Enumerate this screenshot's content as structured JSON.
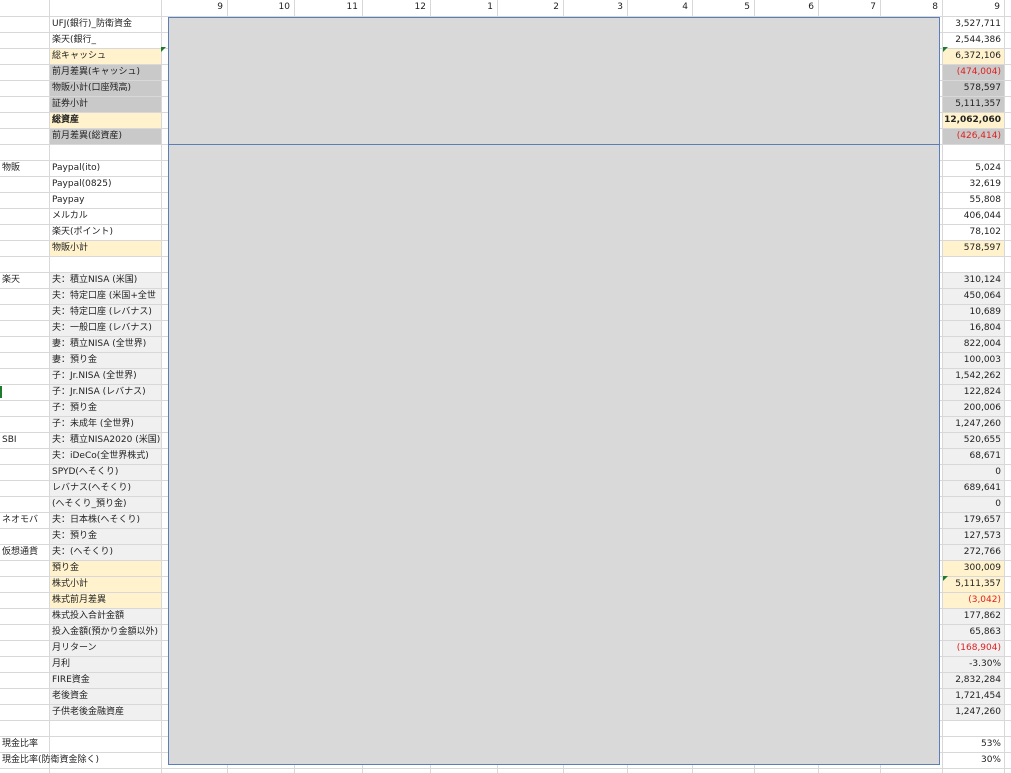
{
  "column_headers": [
    "9",
    "10",
    "11",
    "12",
    "1",
    "2",
    "3",
    "4",
    "5",
    "6",
    "7",
    "8",
    "9"
  ],
  "colors": {
    "gray_fill": "#c9c9c9",
    "yellow_fill": "#fff2cc",
    "band_fill": "#f0f0f0",
    "negative_text": "#e02020",
    "overlay_fill": "#d9d9d9",
    "overlay_border": "#5b7db8"
  },
  "rows": [
    {
      "cat": "",
      "label": "UFJ(銀行)_防衛資金",
      "value": "3,527,711",
      "style": "white"
    },
    {
      "cat": "",
      "label": "楽天(銀行_",
      "value": "2,544,386",
      "style": "white"
    },
    {
      "cat": "",
      "label": "総キャッシュ",
      "value": "6,372,106",
      "style": "yellow"
    },
    {
      "cat": "",
      "label": "前月差異(キャッシュ)",
      "value": "(474,004)",
      "style": "gray",
      "neg": true
    },
    {
      "cat": "",
      "label": "物販小計(口座残高)",
      "value": "578,597",
      "style": "gray"
    },
    {
      "cat": "",
      "label": "証券小計",
      "value": "5,111,357",
      "style": "gray"
    },
    {
      "cat": "",
      "label": "総資産",
      "value": "12,062,060",
      "style": "yellow",
      "bold": true
    },
    {
      "cat": "",
      "label": "前月差異(総資産)",
      "value": "(426,414)",
      "style": "gray",
      "neg": true
    },
    {
      "cat": "",
      "label": "",
      "value": "",
      "style": "white"
    },
    {
      "cat": "物販",
      "label": "Paypal(ito)",
      "value": "5,024",
      "style": "white"
    },
    {
      "cat": "",
      "label": "Paypal(0825)",
      "value": "32,619",
      "style": "white"
    },
    {
      "cat": "",
      "label": "Paypay",
      "value": "55,808",
      "style": "white"
    },
    {
      "cat": "",
      "label": "メルカル",
      "value": "406,044",
      "style": "white"
    },
    {
      "cat": "",
      "label": "楽天(ポイント)",
      "value": "78,102",
      "style": "white"
    },
    {
      "cat": "",
      "label": "物販小計",
      "value": "578,597",
      "style": "yellow"
    },
    {
      "cat": "",
      "label": "",
      "value": "",
      "style": "white"
    },
    {
      "cat": "楽天",
      "label": "夫：積立NISA (米国)",
      "value": "310,124",
      "style": "band"
    },
    {
      "cat": "",
      "label": "夫：特定口座 (米国+全世",
      "value": "450,064",
      "style": "band"
    },
    {
      "cat": "",
      "label": "夫：特定口座 (レバナス)",
      "value": "10,689",
      "style": "band"
    },
    {
      "cat": "",
      "label": "夫：一般口座 (レバナス)",
      "value": "16,804",
      "style": "band"
    },
    {
      "cat": "",
      "label": "妻：積立NISA (全世界)",
      "value": "822,004",
      "style": "band"
    },
    {
      "cat": "",
      "label": "妻：預り金",
      "value": "100,003",
      "style": "band"
    },
    {
      "cat": "",
      "label": "子：Jr.NISA (全世界)",
      "value": "1,542,262",
      "style": "band"
    },
    {
      "cat": "",
      "label": "子：Jr.NISA (レバナス)",
      "value": "122,824",
      "style": "band"
    },
    {
      "cat": "",
      "label": "子：預り金",
      "value": "200,006",
      "style": "band"
    },
    {
      "cat": "",
      "label": "子：未成年 (全世界)",
      "value": "1,247,260",
      "style": "band"
    },
    {
      "cat": "SBI",
      "label": "夫：積立NISA2020 (米国)",
      "value": "520,655",
      "style": "band"
    },
    {
      "cat": "",
      "label": "夫：iDeCo(全世界株式)",
      "value": "68,671",
      "style": "band"
    },
    {
      "cat": "",
      "label": "SPYD(へそくり)",
      "value": "0",
      "style": "band"
    },
    {
      "cat": "",
      "label": "レバナス(へそくり)",
      "value": "689,641",
      "style": "band"
    },
    {
      "cat": "",
      "label": "(へそくり_預り金)",
      "value": "0",
      "style": "band"
    },
    {
      "cat": "ネオモバ",
      "label": "夫：日本株(へそくり)",
      "value": "179,657",
      "style": "band"
    },
    {
      "cat": "",
      "label": "夫：預り金",
      "value": "127,573",
      "style": "band"
    },
    {
      "cat": "仮想通貨",
      "label": "夫：(へそくり)",
      "value": "272,766",
      "style": "band"
    },
    {
      "cat": "",
      "label": "預り金",
      "value": "300,009",
      "style": "yellow"
    },
    {
      "cat": "",
      "label": "株式小計",
      "value": "5,111,357",
      "style": "yellow"
    },
    {
      "cat": "",
      "label": "株式前月差異",
      "value": "(3,042)",
      "style": "yellow",
      "neg": true
    },
    {
      "cat": "",
      "label": "株式投入合計金額",
      "value": "177,862",
      "style": "band"
    },
    {
      "cat": "",
      "label": "投入金額(預かり金額以外)",
      "value": "65,863",
      "style": "band"
    },
    {
      "cat": "",
      "label": "月リターン",
      "value": "(168,904)",
      "style": "band",
      "neg": true
    },
    {
      "cat": "",
      "label": "月利",
      "value": "-3.30%",
      "style": "band"
    },
    {
      "cat": "",
      "label": "FIRE資金",
      "value": "2,832,284",
      "style": "band"
    },
    {
      "cat": "",
      "label": "老後資金",
      "value": "1,721,454",
      "style": "band"
    },
    {
      "cat": "",
      "label": "子供老後金融資産",
      "value": "1,247,260",
      "style": "band"
    },
    {
      "cat": "",
      "label": "",
      "value": "",
      "style": "white"
    },
    {
      "cat": "現金比率",
      "label": "",
      "value": "53%",
      "style": "white"
    },
    {
      "cat": "現金比率(防衛資金除く)",
      "label": "",
      "value": "30%",
      "style": "white"
    }
  ]
}
